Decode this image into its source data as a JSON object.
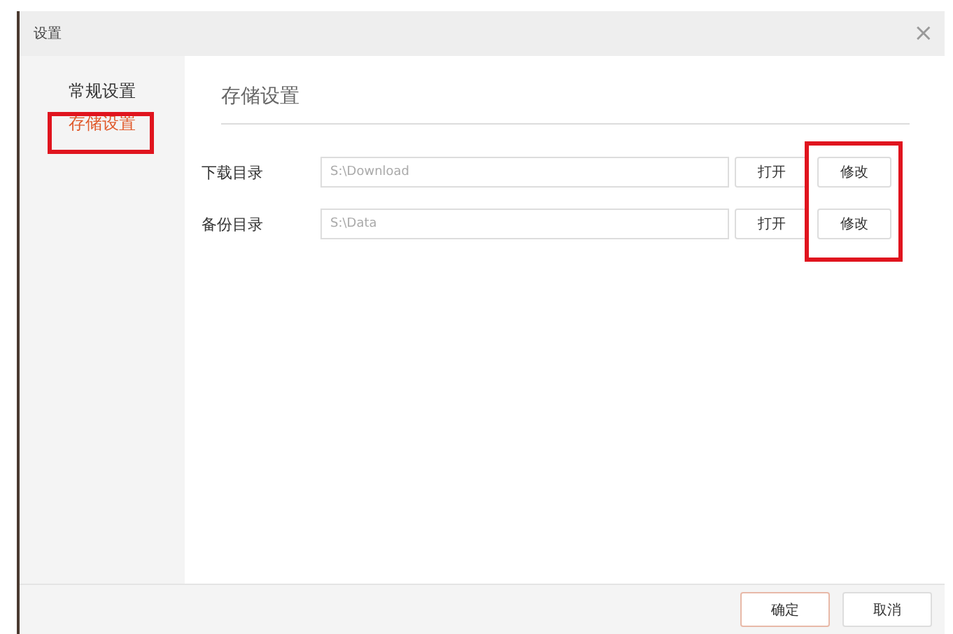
{
  "window": {
    "title": "设置",
    "close": "×"
  },
  "sidebar": {
    "items": [
      {
        "label": "常规设置",
        "selected": false
      },
      {
        "label": "存储设置",
        "selected": true
      }
    ]
  },
  "content": {
    "heading": "存储设置",
    "rows": [
      {
        "label": "下载目录",
        "value": "S:\\Download",
        "buttons": [
          "打开",
          "修改"
        ]
      },
      {
        "label": "备份目录",
        "value": "S:\\Data",
        "buttons": [
          "打开",
          "修改"
        ]
      }
    ]
  },
  "footer": {
    "buttons": [
      {
        "label": "确定",
        "primary": true
      },
      {
        "label": "取消",
        "primary": false
      }
    ]
  }
}
